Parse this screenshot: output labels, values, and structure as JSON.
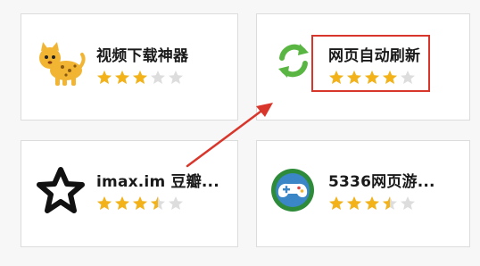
{
  "apps": [
    {
      "name": "视频下载神器",
      "icon": "cheetah-icon",
      "rating": 3
    },
    {
      "name": "网页自动刷新",
      "icon": "refresh-icon",
      "rating": 4
    },
    {
      "name": "imax.im 豆瓣...",
      "icon": "star-outline-icon",
      "rating": 3.5
    },
    {
      "name": "5336网页游...",
      "icon": "game-controller-icon",
      "rating": 3.5
    }
  ],
  "colors": {
    "star_filled": "#f3b318",
    "star_empty": "#dddddd",
    "highlight": "#d9362b",
    "refresh_green": "#5ab642"
  }
}
